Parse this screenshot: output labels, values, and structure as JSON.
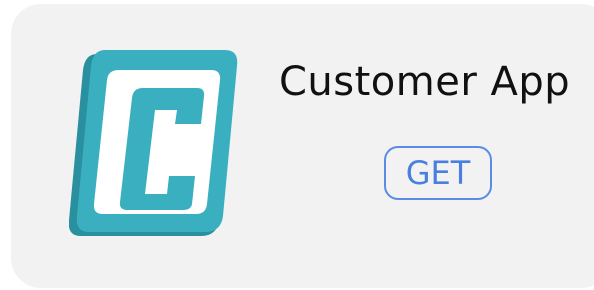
{
  "app": {
    "name": "Customer App",
    "icon": "customer-app-c-logo-icon",
    "get_label": "GET"
  },
  "colors": {
    "card_bg": "#f2f2f2",
    "logo_teal": "#3aafc0",
    "logo_teal_dark": "#2a8f9e",
    "button_blue": "#4a7fe0"
  }
}
